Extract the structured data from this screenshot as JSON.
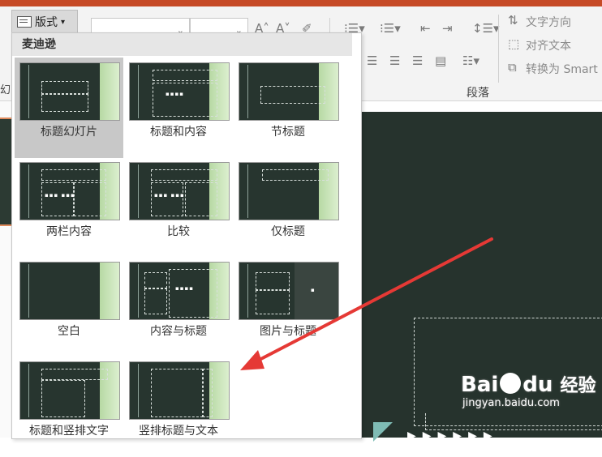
{
  "ribbon": {
    "layout_label": "版式",
    "text_direction": "文字方向",
    "align_text": "对齐文本",
    "convert_smart": "转换为 Smart",
    "paragraph_group": "段落",
    "left_marker": "幻"
  },
  "dropdown": {
    "section_title": "麦迪逊",
    "layouts": [
      {
        "label": "标题幻灯片",
        "selected": true
      },
      {
        "label": "标题和内容"
      },
      {
        "label": "节标题"
      },
      {
        "label": "两栏内容"
      },
      {
        "label": "比较"
      },
      {
        "label": "仅标题"
      },
      {
        "label": "空白"
      },
      {
        "label": "内容与标题"
      },
      {
        "label": "图片与标题"
      },
      {
        "label": "标题和竖排文字"
      },
      {
        "label": "竖排标题与文本"
      }
    ]
  },
  "watermark": {
    "brand_a": "Bai",
    "brand_b": "du",
    "brand_cn": "经验",
    "url": "jingyan.baidu.com"
  },
  "colors": {
    "accent": "#c64a26",
    "slide_bg": "#26332d",
    "arrow": "#e53935"
  }
}
